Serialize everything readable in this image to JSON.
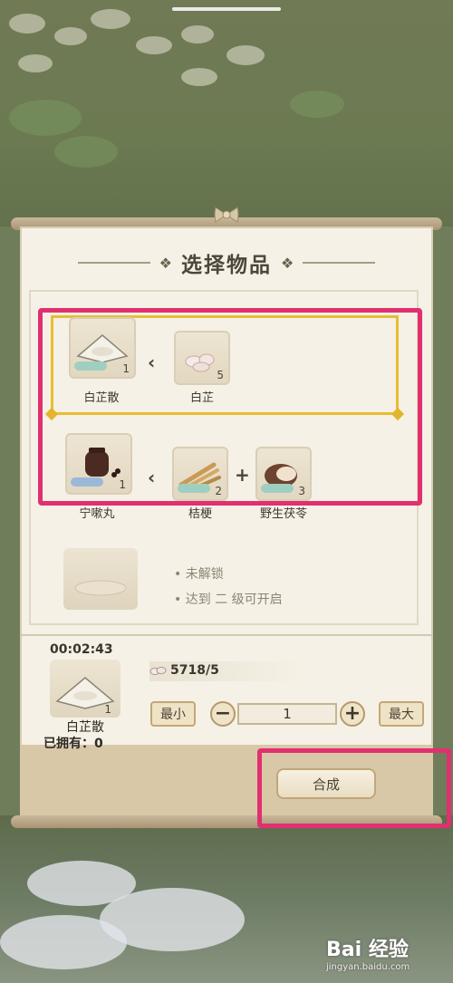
{
  "panel": {
    "title": "选择物品"
  },
  "recipes": [
    {
      "product": {
        "name": "白芷散",
        "count": "1",
        "icon": "white-powder-icon"
      },
      "ingredients": [
        {
          "name": "白芷",
          "count": "5",
          "icon": "angelica-root-icon"
        }
      ],
      "selected": true
    },
    {
      "product": {
        "name": "宁嗽丸",
        "count": "1",
        "icon": "pill-jar-icon"
      },
      "ingredients": [
        {
          "name": "桔梗",
          "count": "2",
          "icon": "platycodon-root-icon"
        },
        {
          "name": "野生茯苓",
          "count": "3",
          "icon": "poria-icon"
        }
      ],
      "selected": false
    }
  ],
  "locked": {
    "line1": "未解锁",
    "line2": "达到 二 级可开启"
  },
  "crafting": {
    "timer": "00:02:43",
    "item_name": "白芷散",
    "item_count": "1",
    "owned": "已拥有：0",
    "cost": "5718/5"
  },
  "controls": {
    "min_label": "最小",
    "max_label": "最大",
    "minus": "−",
    "plus": "+",
    "quantity": "1",
    "craft_label": "合成"
  },
  "watermark": {
    "brand": "Bai 经验",
    "url": "jingyan.baidu.com"
  },
  "colors": {
    "highlight": "#e0306f",
    "selected_border": "#e7bd33",
    "panel_bg": "#f6f1e6"
  }
}
